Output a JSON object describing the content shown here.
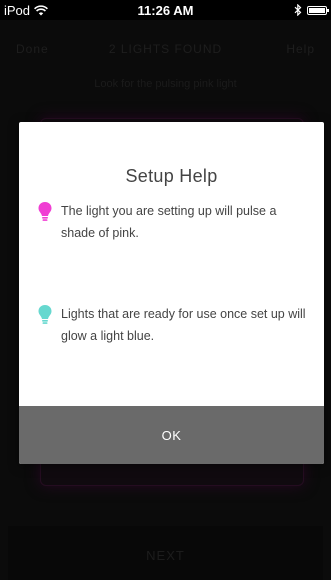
{
  "status_bar": {
    "device": "iPod",
    "time": "11:26 AM"
  },
  "nav": {
    "left": "Done",
    "title": "2 LIGHTS FOUND",
    "right": "Help"
  },
  "instruction": "Look for the pulsing pink light",
  "next_label": "NEXT",
  "modal": {
    "title": "Setup Help",
    "items": [
      {
        "icon": "pink-bulb-icon",
        "color": "#f03ed3",
        "text": "The light you are setting up will pulse a shade of pink."
      },
      {
        "icon": "blue-bulb-icon",
        "color": "#66d8cf",
        "text": "Lights that are ready for use once set up will glow a light blue."
      }
    ],
    "ok_label": "OK"
  },
  "colors": {
    "pink": "#f03ed3",
    "light_blue": "#66d8cf",
    "ok_button": "#6a6a6a"
  }
}
